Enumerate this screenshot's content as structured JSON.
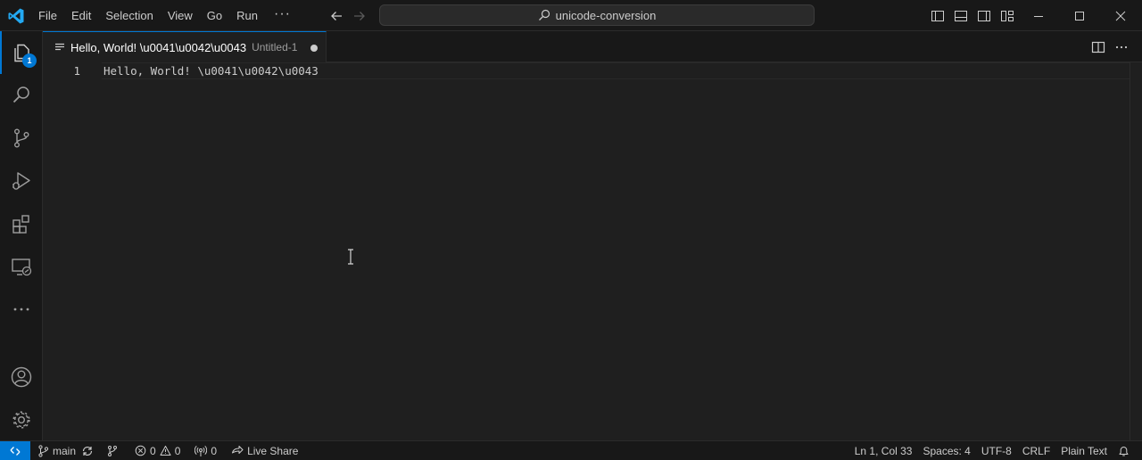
{
  "menu": {
    "items": [
      "File",
      "Edit",
      "Selection",
      "View",
      "Go",
      "Run"
    ],
    "more": "···"
  },
  "search": {
    "text": "unicode-conversion"
  },
  "tab": {
    "title": "Hello, World! \\u0041\\u0042\\u0043",
    "description": "Untitled-1"
  },
  "explorer_badge": "1",
  "editor": {
    "line_number": "1",
    "line_text": "Hello, World! \\u0041\\u0042\\u0043"
  },
  "status": {
    "branch": "main",
    "errors": "0",
    "warnings": "0",
    "ports": "0",
    "live_share": "Live Share",
    "position": "Ln 1, Col 33",
    "spaces": "Spaces: 4",
    "encoding": "UTF-8",
    "eol": "CRLF",
    "language": "Plain Text"
  },
  "colors": {
    "accent": "#0078d4",
    "logo": "#23a9f2",
    "background": "#1f1f1f",
    "chrome": "#181818"
  },
  "icons": [
    "vscode-logo",
    "arrow-left-icon",
    "arrow-right-icon",
    "search-icon",
    "toggle-primary-sidebar-icon",
    "toggle-panel-icon",
    "toggle-secondary-sidebar-icon",
    "customize-layout-icon",
    "minimize-icon",
    "maximize-icon",
    "close-icon",
    "explorer-icon",
    "search-view-icon",
    "source-control-icon",
    "run-debug-icon",
    "extensions-icon",
    "remote-explorer-icon",
    "more-icon",
    "accounts-icon",
    "manage-gear-icon",
    "split-editor-icon",
    "editor-more-actions-icon",
    "remote-indicator-icon",
    "branch-icon",
    "sync-icon",
    "error-icon",
    "warning-icon",
    "ports-icon",
    "live-share-icon",
    "bell-icon"
  ]
}
